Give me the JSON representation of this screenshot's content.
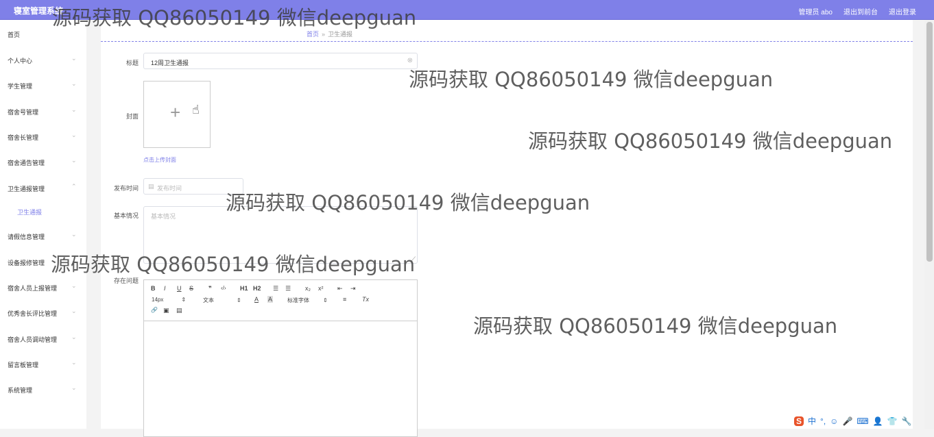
{
  "app": {
    "title": "寝室管理系统"
  },
  "topbar": {
    "user": "管理员 abo",
    "back_front": "退出到前台",
    "logout": "退出登录"
  },
  "sidebar": {
    "items": [
      {
        "label": "首页",
        "chevron": ""
      },
      {
        "label": "个人中心",
        "chevron": "⌄"
      },
      {
        "label": "学生管理",
        "chevron": "⌄"
      },
      {
        "label": "宿舍号管理",
        "chevron": "⌄"
      },
      {
        "label": "宿舍长管理",
        "chevron": "⌄"
      },
      {
        "label": "宿舍通告管理",
        "chevron": "⌄"
      },
      {
        "label": "卫生通报管理",
        "chevron": "⌃"
      },
      {
        "label": "卫生通报",
        "chevron": ""
      },
      {
        "label": "请假信息管理",
        "chevron": "⌄"
      },
      {
        "label": "设备报修管理",
        "chevron": "⌄"
      },
      {
        "label": "宿舍人员上报管理",
        "chevron": "⌄"
      },
      {
        "label": "优秀舍长评比管理",
        "chevron": "⌄"
      },
      {
        "label": "宿舍人员调动管理",
        "chevron": "⌄"
      },
      {
        "label": "留言板管理",
        "chevron": "⌄"
      },
      {
        "label": "系统管理",
        "chevron": "⌄"
      }
    ]
  },
  "breadcrumb": {
    "home": "首页",
    "sep": "»",
    "current": "卫生通报"
  },
  "form": {
    "title_label": "标题",
    "title_value": "12周卫生通报",
    "cover_label": "封面",
    "cover_plus": "+",
    "cover_tip": "点击上传封面",
    "publish_label": "发布时间",
    "publish_placeholder": "发布时间",
    "basic_label": "基本情况",
    "basic_placeholder": "基本情况",
    "issue_label": "存在问题"
  },
  "editor": {
    "bold": "B",
    "italic": "I",
    "underline": "U",
    "strike": "S",
    "quote": "❞",
    "code": "‹/›",
    "h1": "H1",
    "h2": "H2",
    "ol": "☰",
    "ul": "☰",
    "sub": "x₂",
    "sup": "x²",
    "outdent": "⇤",
    "indent": "⇥",
    "size": "14px",
    "para": "文本",
    "font": "标准字体",
    "color": "A",
    "bg": "A",
    "align": "≡",
    "clean": "Tx",
    "link": "🔗",
    "image": "▣",
    "video": "▤"
  },
  "watermarks": [
    "源码获取 QQ86050149 微信deepguan",
    "源码获取 QQ86050149 微信deepguan",
    "源码获取 QQ86050149 微信deepguan",
    "源码获取 QQ86050149 微信deepguan",
    "源码获取 QQ86050149 微信deepguan",
    "源码获取 QQ86050149 微信deepguan"
  ],
  "ime": {
    "logo": "S",
    "mode": "中",
    "punct": "°,",
    "emoji": "☺",
    "mic": "🎤",
    "kbd": "⌨",
    "user": "👤",
    "skin": "👕",
    "tool": "🔧"
  }
}
